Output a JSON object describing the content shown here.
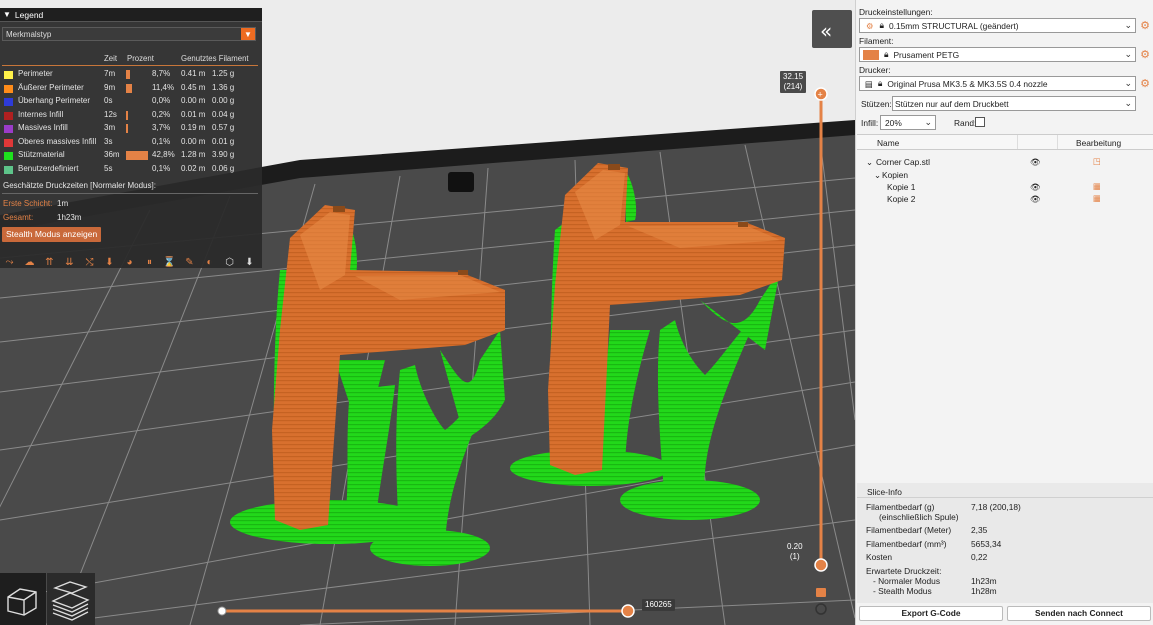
{
  "colors": {
    "accent": "#ed6b21",
    "model_orange": "#d8702e",
    "support_green": "#22d81a"
  },
  "legend": {
    "title": "Legend",
    "view_type": "Merkmalstyp",
    "columns": {
      "time": "Zeit",
      "percent": "Prozent",
      "filament": "Genutztes Filament"
    },
    "rows": [
      {
        "color": "#fff14a",
        "name": "Perimeter",
        "time": "7m",
        "percent": "8,7%",
        "fraction": 0.087,
        "meters": "0.41 m",
        "grams": "1.25 g"
      },
      {
        "color": "#ff8c1a",
        "name": "Äußerer Perimeter",
        "time": "9m",
        "percent": "11,4%",
        "fraction": 0.114,
        "meters": "0.45 m",
        "grams": "1.36 g"
      },
      {
        "color": "#2e3bd8",
        "name": "Überhang Perimeter",
        "time": "0s",
        "percent": "0,0%",
        "fraction": 0.0,
        "meters": "0.00 m",
        "grams": "0.00 g"
      },
      {
        "color": "#b02020",
        "name": "Internes Infill",
        "time": "12s",
        "percent": "0,2%",
        "fraction": 0.002,
        "meters": "0.01 m",
        "grams": "0.04 g"
      },
      {
        "color": "#9a3cc8",
        "name": "Massives Infill",
        "time": "3m",
        "percent": "3,7%",
        "fraction": 0.037,
        "meters": "0.19 m",
        "grams": "0.57 g"
      },
      {
        "color": "#e03838",
        "name": "Oberes massives Infill",
        "time": "3s",
        "percent": "0,1%",
        "fraction": 0.001,
        "meters": "0.00 m",
        "grams": "0.01 g"
      },
      {
        "color": "#1ee01e",
        "name": "Stützmaterial",
        "time": "36m",
        "percent": "42,8%",
        "fraction": 0.428,
        "meters": "1.28 m",
        "grams": "3.90 g"
      },
      {
        "color": "#5ec48a",
        "name": "Benutzerdefiniert",
        "time": "5s",
        "percent": "0,1%",
        "fraction": 0.001,
        "meters": "0.02 m",
        "grams": "0.06 g"
      }
    ],
    "estimated_label": "Geschätzte Druckzeiten [Normaler Modus]:",
    "first_layer_label": "Erste Schicht:",
    "first_layer_value": "1m",
    "total_label": "Gesamt:",
    "total_value": "1h23m",
    "stealth_button": "Stealth Modus anzeigen"
  },
  "vertical_slider": {
    "top_value": "32.15",
    "top_layer": "(214)",
    "bottom_value": "0.20",
    "bottom_layer": "(1)"
  },
  "horizontal_slider": {
    "value": "160265"
  },
  "right_panel": {
    "print_settings_label": "Druckeinstellungen:",
    "print_settings_value": "0.15mm STRUCTURAL (geändert)",
    "filament_label": "Filament:",
    "filament_value": "Prusament PETG",
    "printer_label": "Drucker:",
    "printer_value": "Original Prusa MK3.5 & MK3.5S 0.4 nozzle",
    "supports_label": "Stützen:",
    "supports_value": "Stützen nur auf dem Druckbett",
    "infill_label": "Infill:",
    "infill_value": "20%",
    "brim_label": "Rand:",
    "objects_header_name": "Name",
    "objects_header_edit": "Bearbeitung",
    "object_name": "Corner Cap.stl",
    "copies_label": "Kopien",
    "copy1": "Kopie 1",
    "copy2": "Kopie 2"
  },
  "slice_info": {
    "title": "Slice-Info",
    "filament_g_label": "Filamentbedarf (g)",
    "filament_g_sub": "(einschließlich Spule)",
    "filament_g_value": "7,18 (200,18)",
    "filament_m_label": "Filamentbedarf (Meter)",
    "filament_m_value": "2,35",
    "filament_mm3_label": "Filamentbedarf (mm³)",
    "filament_mm3_value": "5653,34",
    "cost_label": "Kosten",
    "cost_value": "0,22",
    "time_label": "Erwartete Druckzeit:",
    "normal_label": "- Normaler Modus",
    "normal_value": "1h23m",
    "stealth_label": "- Stealth Modus",
    "stealth_value": "1h28m"
  },
  "buttons": {
    "export": "Export G-Code",
    "send": "Senden nach Connect"
  }
}
